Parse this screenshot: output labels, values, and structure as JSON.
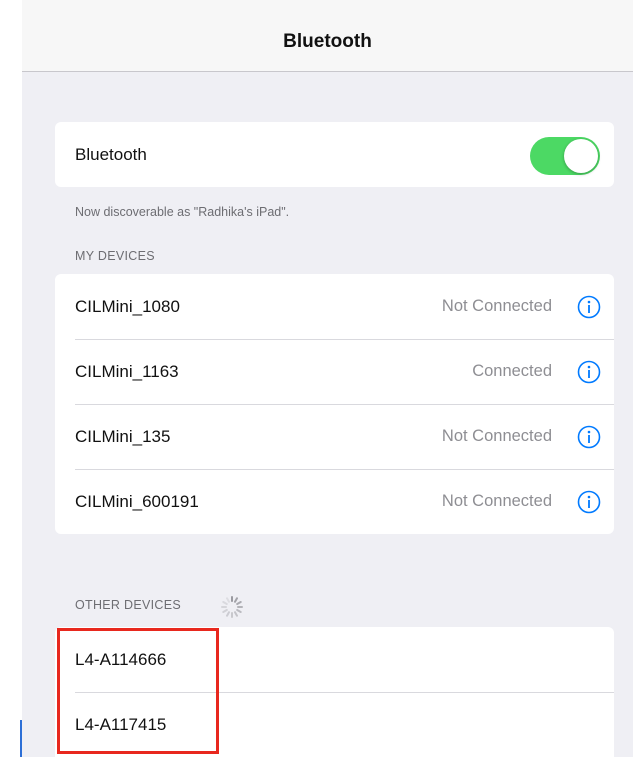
{
  "navbar": {
    "title": "Bluetooth"
  },
  "bluetooth_toggle": {
    "label": "Bluetooth",
    "state": "on",
    "color": "#4cd964"
  },
  "discoverable_text": "Now discoverable as \"Radhika's iPad\".",
  "my_devices": {
    "header": "MY DEVICES",
    "items": [
      {
        "name": "CILMini_1080",
        "status": "Not Connected",
        "icon": "info-icon"
      },
      {
        "name": "CILMini_1163",
        "status": "Connected",
        "icon": "info-icon"
      },
      {
        "name": "CILMini_135",
        "status": "Not Connected",
        "icon": "info-icon"
      },
      {
        "name": "CILMini_600191",
        "status": "Not Connected",
        "icon": "info-icon"
      }
    ]
  },
  "other_devices": {
    "header": "OTHER DEVICES",
    "loading_icon": "spinner-icon",
    "items": [
      {
        "name": "L4-A114666"
      },
      {
        "name": "L4-A117415"
      }
    ]
  },
  "colors": {
    "accent": "#007aff",
    "toggle_on": "#4cd964",
    "highlight": "#e8281e"
  }
}
